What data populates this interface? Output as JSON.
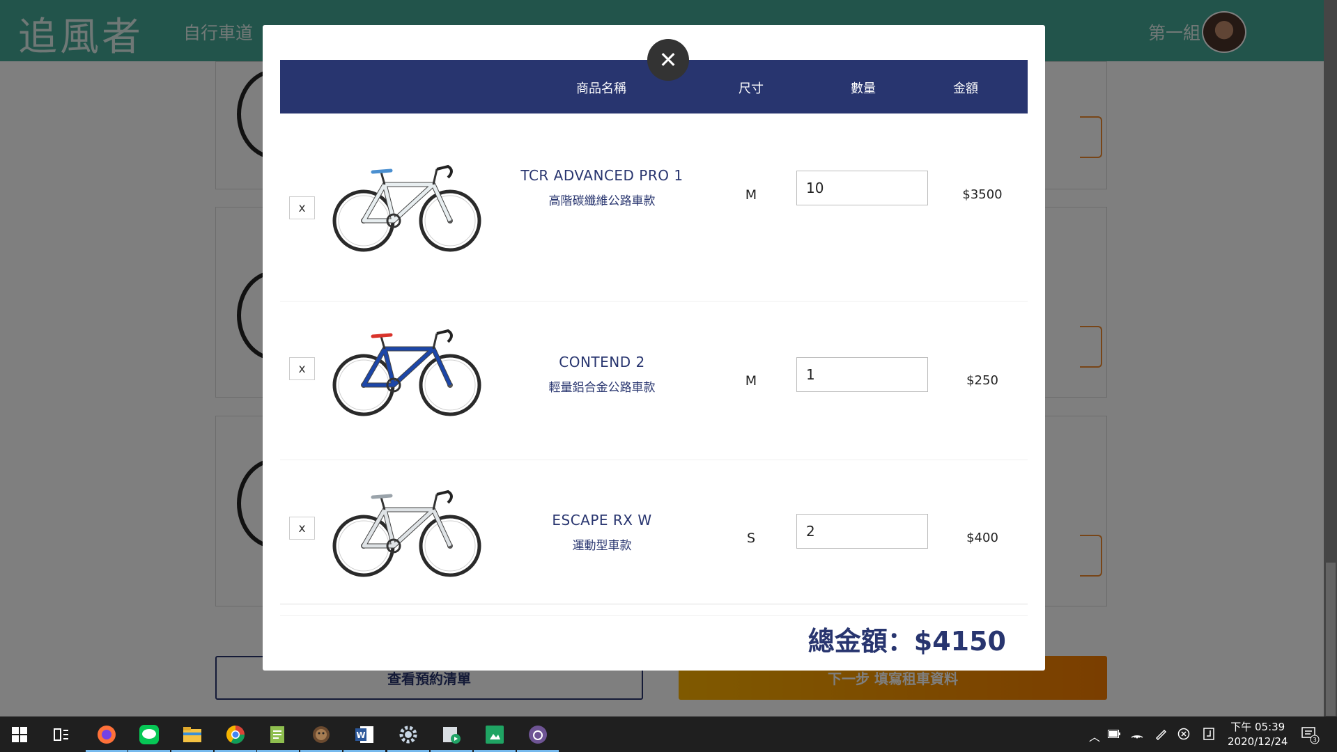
{
  "site": {
    "logo": "追風者",
    "nav_link": "自行車道",
    "user_name": "第一組",
    "btn_view_list": "查看預約清單",
    "btn_next": "下一步 填寫租車資料"
  },
  "cart": {
    "columns": {
      "name": "商品名稱",
      "size": "尺寸",
      "qty": "數量",
      "amount": "金額"
    },
    "items": [
      {
        "remove": "x",
        "name_en": "TCR ADVANCED PRO 1",
        "name_zh": "高階碳纖維公路車款",
        "size": "M",
        "qty": "10",
        "amount": "$3500",
        "frame_color": "#e8eef0",
        "accent_color": "#4a8fd0"
      },
      {
        "remove": "x",
        "name_en": "CONTEND 2",
        "name_zh": "輕量鋁合金公路車款",
        "size": "M",
        "qty": "1",
        "amount": "$250",
        "frame_color": "#1c46a8",
        "accent_color": "#d9332b"
      },
      {
        "remove": "x",
        "name_en": "ESCAPE RX W",
        "name_zh": "運動型車款",
        "size": "S",
        "qty": "2",
        "amount": "$400",
        "frame_color": "#dfe3e6",
        "accent_color": "#9aa3aa"
      }
    ],
    "total_label": "總金額：$4150",
    "close_icon": "✕"
  },
  "taskbar": {
    "apps": [
      "firefox-icon",
      "line-icon",
      "file-explorer-icon",
      "chrome-icon",
      "notepad-icon",
      "bear-app-icon",
      "word-icon",
      "settings-icon",
      "media-icon",
      "sheets-icon",
      "github-icon"
    ],
    "time": "下午 05:39",
    "date": "2020/12/24",
    "notification_count": "3"
  },
  "colors": {
    "navy": "#28356f",
    "nav_green": "#45a896",
    "orange": "#f57c00"
  }
}
